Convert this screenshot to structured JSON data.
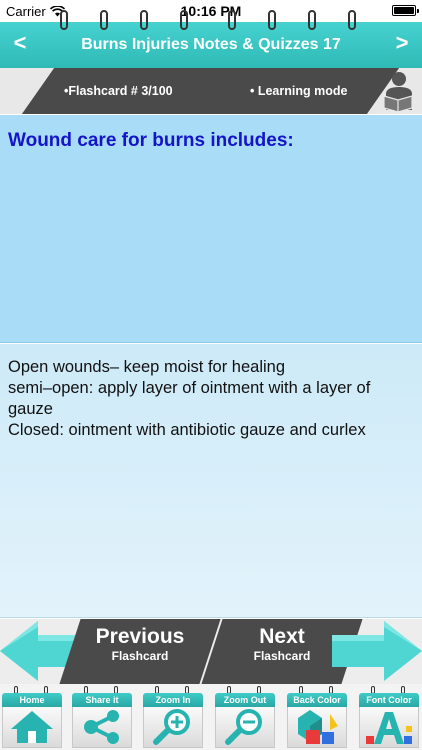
{
  "status_bar": {
    "carrier": "Carrier",
    "time": "10:16 PM"
  },
  "header": {
    "title": "Burns Injuries Notes & Quizzes 17",
    "prev_symbol": "<",
    "next_symbol": ">"
  },
  "info": {
    "flashcard": "•Flashcard #  3/100",
    "mode": "• Learning mode"
  },
  "question": "Wound care for burns includes:",
  "answer_lines": [
    "Open wounds– keep moist for healing",
    "semi–open: apply layer of ointment with a layer of gauze",
    "Closed: ointment with antibiotic gauze and curlex"
  ],
  "nav_buttons": {
    "previous": {
      "label": "Previous",
      "sub": "Flashcard"
    },
    "next": {
      "label": "Next",
      "sub": "Flashcard"
    }
  },
  "toolbar": [
    {
      "label": "Home",
      "icon": "home-icon"
    },
    {
      "label": "Share it",
      "icon": "share-icon"
    },
    {
      "label": "Zoom In",
      "icon": "zoom-in-icon"
    },
    {
      "label": "Zoom Out",
      "icon": "zoom-out-icon"
    },
    {
      "label": "Back Color",
      "icon": "back-color-icon"
    },
    {
      "label": "Font Color",
      "icon": "font-color-icon"
    }
  ],
  "colors": {
    "teal": "#2fbab6",
    "question_bg": "#a9dcf6",
    "question_text": "#1414c8",
    "dark_panel": "#4a4a4a"
  }
}
